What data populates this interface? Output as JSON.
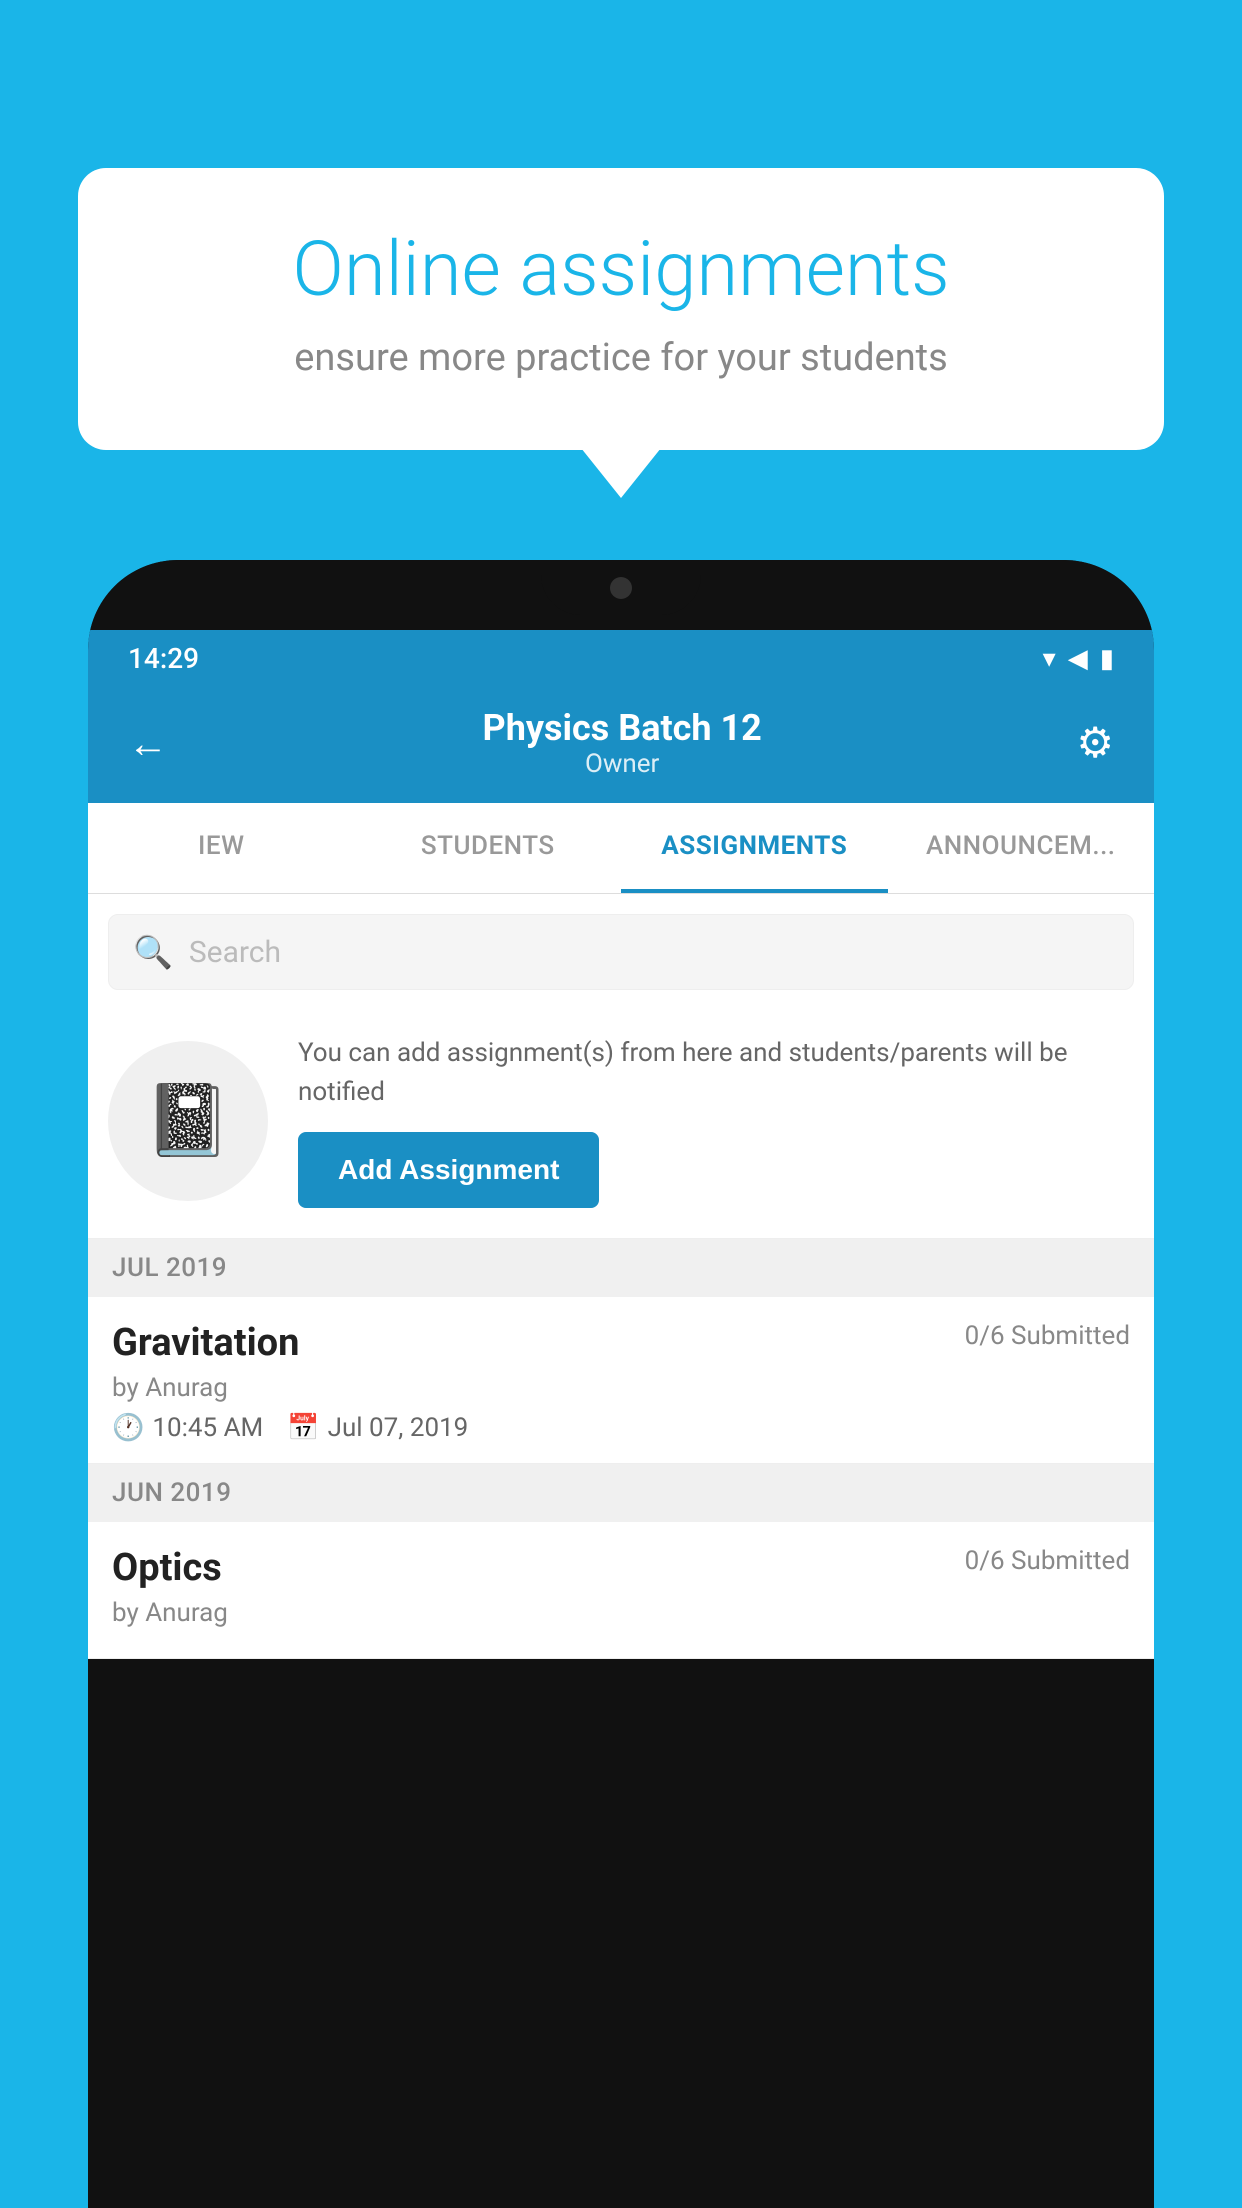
{
  "background_color": "#1ab5e8",
  "speech_bubble": {
    "title": "Online assignments",
    "subtitle": "ensure more practice for your students"
  },
  "status_bar": {
    "time": "14:29",
    "wifi": "▾",
    "signal": "▲",
    "battery": "▮"
  },
  "header": {
    "title": "Physics Batch 12",
    "subtitle": "Owner",
    "back_label": "←",
    "settings_label": "⚙"
  },
  "tabs": [
    {
      "label": "IEW",
      "active": false
    },
    {
      "label": "STUDENTS",
      "active": false
    },
    {
      "label": "ASSIGNMENTS",
      "active": true
    },
    {
      "label": "ANNOUNCEM...",
      "active": false
    }
  ],
  "search": {
    "placeholder": "Search"
  },
  "add_assignment_section": {
    "description": "You can add assignment(s) from here and students/parents will be notified",
    "button_label": "Add Assignment"
  },
  "assignment_groups": [
    {
      "month_label": "JUL 2019",
      "items": [
        {
          "name": "Gravitation",
          "submitted": "0/6 Submitted",
          "by": "by Anurag",
          "time": "10:45 AM",
          "date": "Jul 07, 2019"
        }
      ]
    },
    {
      "month_label": "JUN 2019",
      "items": [
        {
          "name": "Optics",
          "submitted": "0/6 Submitted",
          "by": "by Anurag",
          "time": "",
          "date": ""
        }
      ]
    }
  ]
}
